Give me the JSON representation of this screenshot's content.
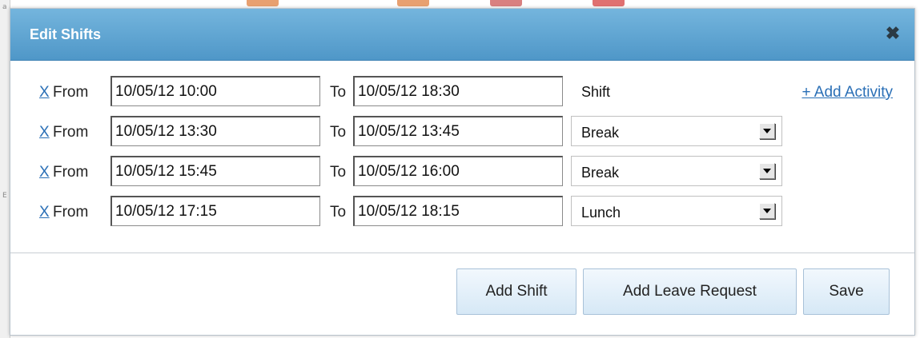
{
  "background": {
    "strip_colors": [
      "#e8a070",
      "#e8a070",
      "#d98080",
      "#e07070"
    ],
    "side_marks": [
      "a",
      "E"
    ]
  },
  "dialog": {
    "title": "Edit Shifts",
    "close_icon": "close-icon",
    "add_activity_label": "+ Add Activity",
    "remove_label": "X",
    "from_label": "From",
    "to_label": "To",
    "rows": [
      {
        "from": "10/05/12 10:00",
        "to": "10/05/12 18:30",
        "type": "Shift",
        "editable_type": false
      },
      {
        "from": "10/05/12 13:30",
        "to": "10/05/12 13:45",
        "type": "Break",
        "editable_type": true
      },
      {
        "from": "10/05/12 15:45",
        "to": "10/05/12 16:00",
        "type": "Break",
        "editable_type": true
      },
      {
        "from": "10/05/12 17:15",
        "to": "10/05/12 18:15",
        "type": "Lunch",
        "editable_type": true
      }
    ],
    "buttons": {
      "add_shift": "Add Shift",
      "add_leave_request": "Add Leave Request",
      "save": "Save"
    }
  },
  "colors": {
    "titlebar": "#5aa3d3",
    "link": "#2a6fb6",
    "button_bg": "#dcebf8"
  }
}
